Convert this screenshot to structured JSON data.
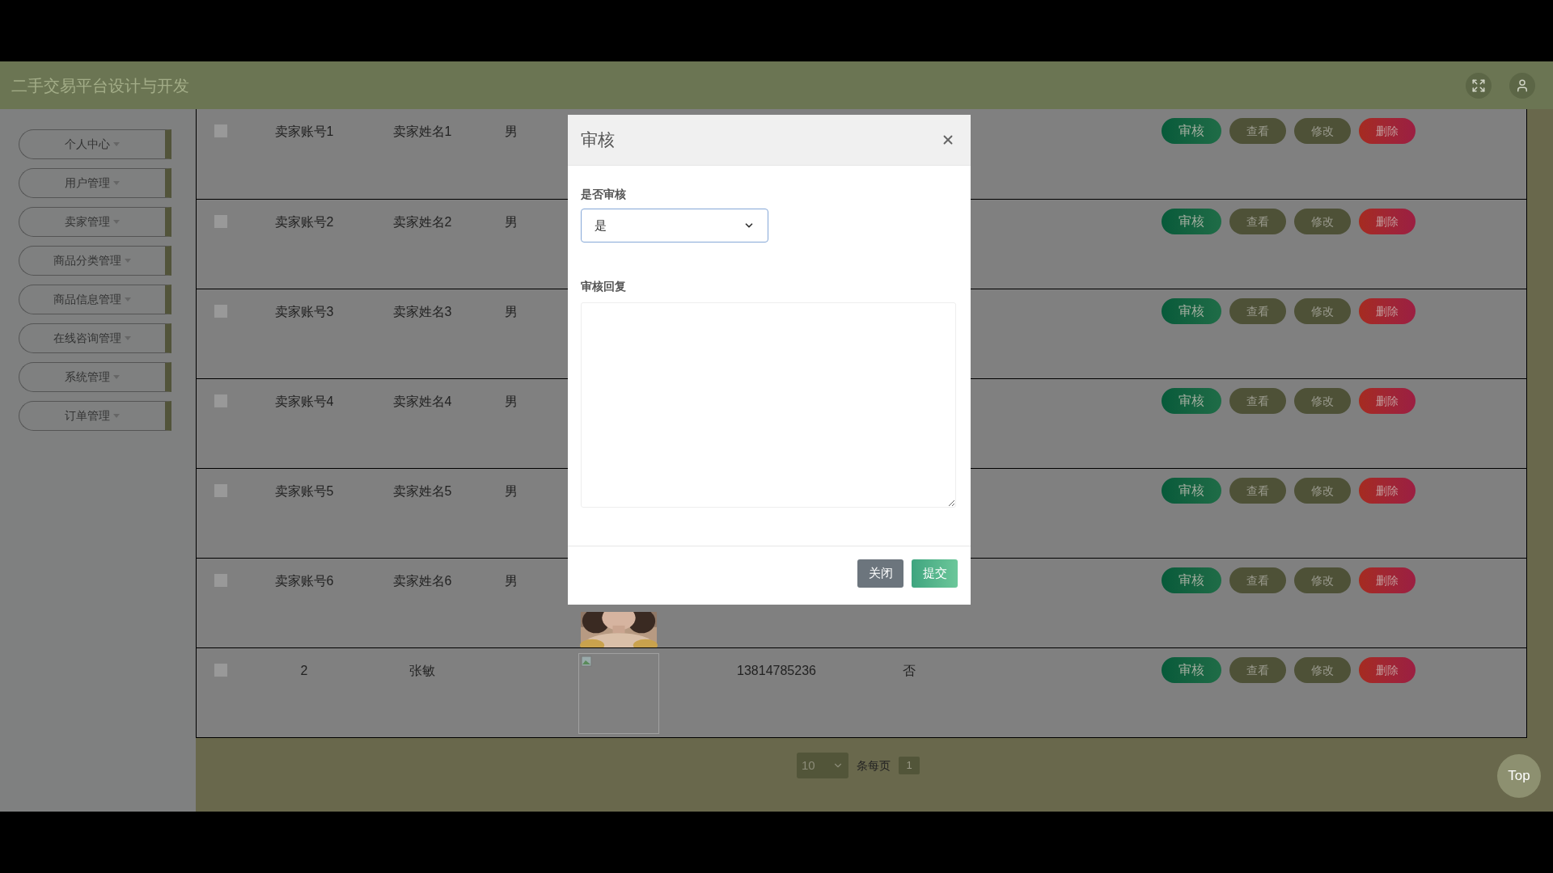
{
  "header": {
    "title": "二手交易平台设计与开发"
  },
  "sidebar": {
    "items": [
      {
        "label": "个人中心"
      },
      {
        "label": "用户管理"
      },
      {
        "label": "卖家管理"
      },
      {
        "label": "商品分类管理"
      },
      {
        "label": "商品信息管理"
      },
      {
        "label": "在线咨询管理"
      },
      {
        "label": "系统管理"
      },
      {
        "label": "订单管理"
      }
    ]
  },
  "table": {
    "rows": [
      {
        "checked": false,
        "account": "卖家账号1",
        "name": "卖家姓名1",
        "gender": "男",
        "actions": [
          {
            "label": "审核",
            "kind": "audit"
          },
          {
            "label": "查看",
            "kind": "view"
          },
          {
            "label": "修改",
            "kind": "edit"
          },
          {
            "label": "删除",
            "kind": "delete"
          }
        ]
      },
      {
        "checked": false,
        "account": "卖家账号2",
        "name": "卖家姓名2",
        "gender": "男",
        "actions": [
          {
            "label": "审核",
            "kind": "audit"
          },
          {
            "label": "查看",
            "kind": "view"
          },
          {
            "label": "修改",
            "kind": "edit"
          },
          {
            "label": "删除",
            "kind": "delete"
          }
        ]
      },
      {
        "checked": false,
        "account": "卖家账号3",
        "name": "卖家姓名3",
        "gender": "男",
        "actions": [
          {
            "label": "审核",
            "kind": "audit"
          },
          {
            "label": "查看",
            "kind": "view"
          },
          {
            "label": "修改",
            "kind": "edit"
          },
          {
            "label": "删除",
            "kind": "delete"
          }
        ]
      },
      {
        "checked": false,
        "account": "卖家账号4",
        "name": "卖家姓名4",
        "gender": "男",
        "actions": [
          {
            "label": "审核",
            "kind": "audit"
          },
          {
            "label": "查看",
            "kind": "view"
          },
          {
            "label": "修改",
            "kind": "edit"
          },
          {
            "label": "删除",
            "kind": "delete"
          }
        ]
      },
      {
        "checked": false,
        "account": "卖家账号5",
        "name": "卖家姓名5",
        "gender": "男",
        "actions": [
          {
            "label": "审核",
            "kind": "audit"
          },
          {
            "label": "查看",
            "kind": "view"
          },
          {
            "label": "修改",
            "kind": "edit"
          },
          {
            "label": "删除",
            "kind": "delete"
          }
        ]
      },
      {
        "checked": false,
        "account": "卖家账号6",
        "name": "卖家姓名6",
        "gender": "男",
        "actions": [
          {
            "label": "审核",
            "kind": "audit"
          },
          {
            "label": "查看",
            "kind": "view"
          },
          {
            "label": "修改",
            "kind": "edit"
          },
          {
            "label": "删除",
            "kind": "delete"
          }
        ]
      },
      {
        "checked": false,
        "account": "2",
        "name": "张敏",
        "image": {
          "kind": "broken"
        },
        "phone": "13814785236",
        "audited": "否",
        "actions": [
          {
            "label": "审核",
            "kind": "audit"
          },
          {
            "label": "查看",
            "kind": "view"
          },
          {
            "label": "修改",
            "kind": "edit"
          },
          {
            "label": "删除",
            "kind": "delete"
          }
        ]
      }
    ]
  },
  "pagination": {
    "page_size": "10",
    "page_size_label": "条每页",
    "pages": [
      {
        "label": "1",
        "selected": true
      }
    ]
  },
  "modal": {
    "title": "审核",
    "fields": [
      {
        "kind": "select",
        "label": "是否审核",
        "value": "是"
      },
      {
        "kind": "textarea",
        "label": "审核回复"
      }
    ],
    "buttons": [
      {
        "label": "关闭",
        "kind": "secondary"
      },
      {
        "label": "提交",
        "kind": "primary"
      }
    ]
  },
  "back_to_top": "Top"
}
